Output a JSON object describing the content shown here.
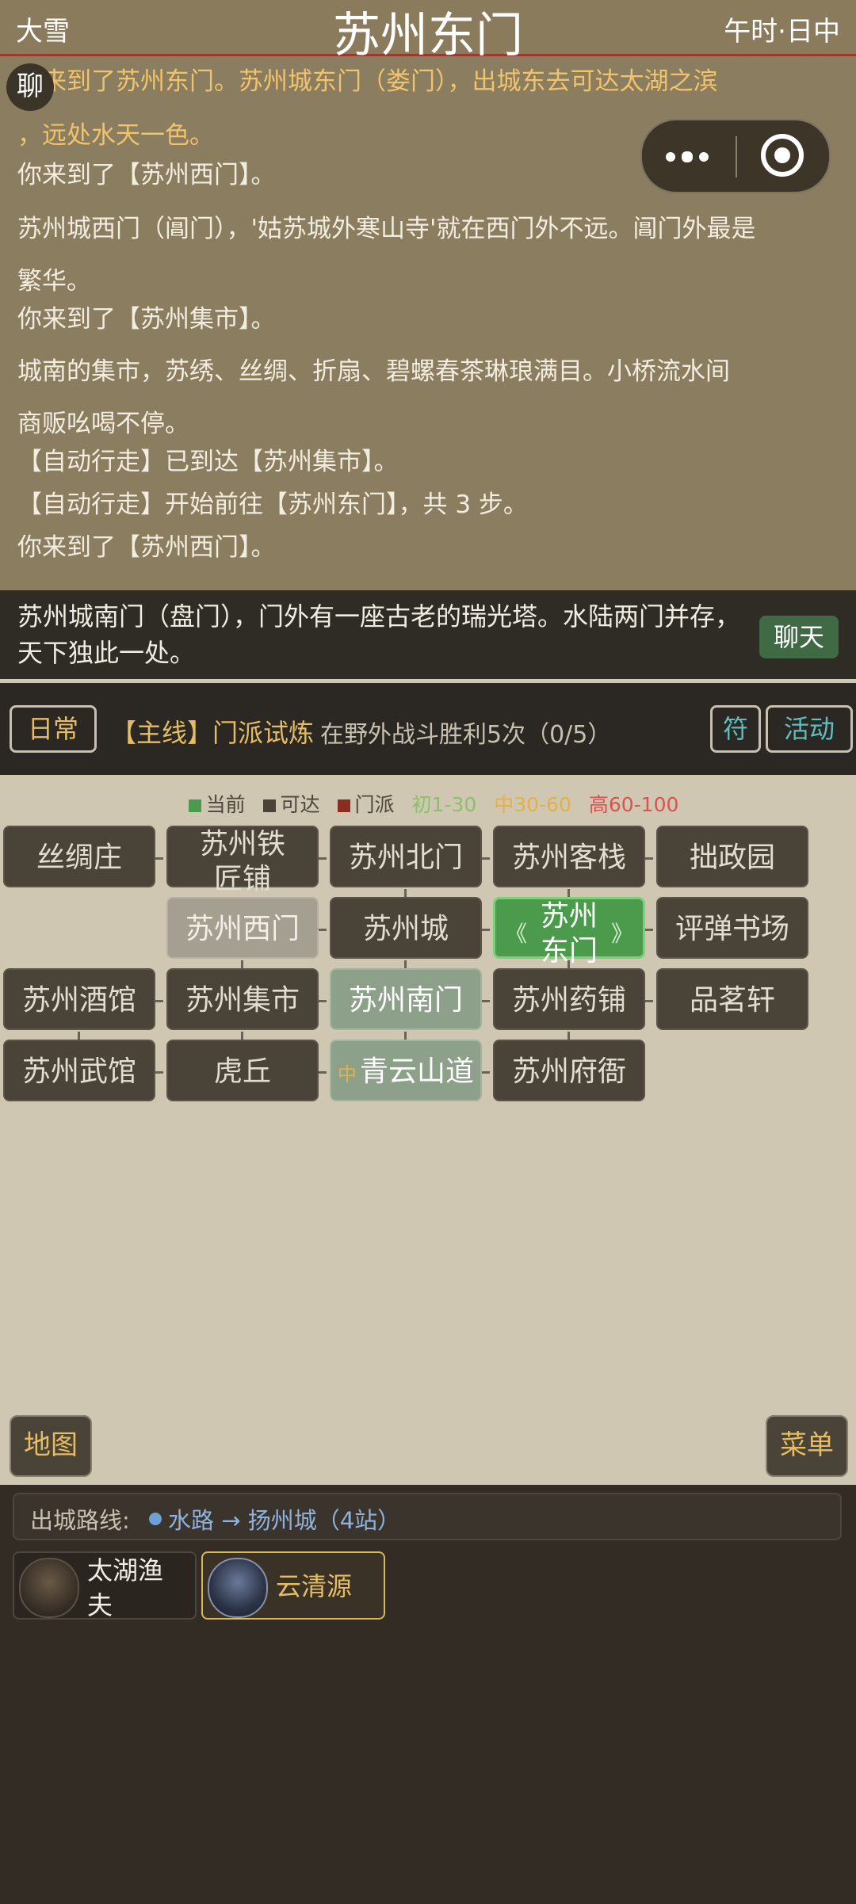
{
  "header": {
    "weather": "大雪",
    "title": "苏州东门",
    "time": "午时·日中"
  },
  "chat_bubble": "聊",
  "log": [
    {
      "text": "你来到了苏州东门。苏州城东门（娄门），出城东去可达太湖之滨",
      "highlight": true
    },
    {
      "text": "，远处水天一色。",
      "highlight": true
    },
    {
      "text": "你来到了【苏州西门】。"
    },
    {
      "text": "苏州城西门（阊门），'姑苏城外寒山寺'就在西门外不远。阊门外最是"
    },
    {
      "text": "繁华。"
    },
    {
      "text": "你来到了【苏州集市】。"
    },
    {
      "text": "城南的集市，苏绣、丝绸、折扇、碧螺春茶琳琅满目。小桥流水间"
    },
    {
      "text": "商贩吆喝不停。"
    },
    {
      "text": "【自动行走】已到达【苏州集市】。"
    },
    {
      "text": "【自动行走】开始前往【苏州东门】，共 3 步。"
    },
    {
      "text": "你来到了【苏州西门】。"
    }
  ],
  "message_bar": {
    "text": "苏州城南门（盘门），门外有一座古老的瑞光塔。水陆两门并存，天下独此一处。",
    "chat_button": "聊天"
  },
  "quest": {
    "daily": "日常",
    "tag": "【主线】门派试炼",
    "desc": "在野外战斗胜利5次（0/5）",
    "fu": "符",
    "activity": "活动"
  },
  "legend": {
    "current": "当前",
    "reachable": "可达",
    "sect": "门派",
    "low": "初1-30",
    "mid": "中30-60",
    "high": "高60-100",
    "colors": {
      "current": "#4c9a4c",
      "reachable": "#4a4338",
      "sect": "#8b2e22",
      "low": "#8dbf6c",
      "mid": "#e3b047",
      "high": "#d9534f"
    }
  },
  "map": {
    "r1c1": "丝绸庄",
    "r1c2": "苏州铁匠铺",
    "r1c3": "苏州北门",
    "r1c4": "苏州客栈",
    "r1c5": "拙政园",
    "r2c2": "苏州西门",
    "r2c3": "苏州城",
    "r2c4": "苏州东门",
    "r2c5": "评弹书场",
    "r3c1": "苏州酒馆",
    "r3c2": "苏州集市",
    "r3c3": "苏州南门",
    "r3c4": "苏州药铺",
    "r3c5": "品茗轩",
    "r4c1": "苏州武馆",
    "r4c2": "虎丘",
    "r4c3": "青云山道",
    "r4c3_tag": "中",
    "r4c4": "苏州府衙"
  },
  "buttons": {
    "map": "地图",
    "menu": "菜单"
  },
  "route": {
    "label": "出城路线:",
    "text": "水路 → 扬州城（4站）"
  },
  "npcs": [
    {
      "name": "太湖渔夫"
    },
    {
      "name": "云清源"
    }
  ]
}
